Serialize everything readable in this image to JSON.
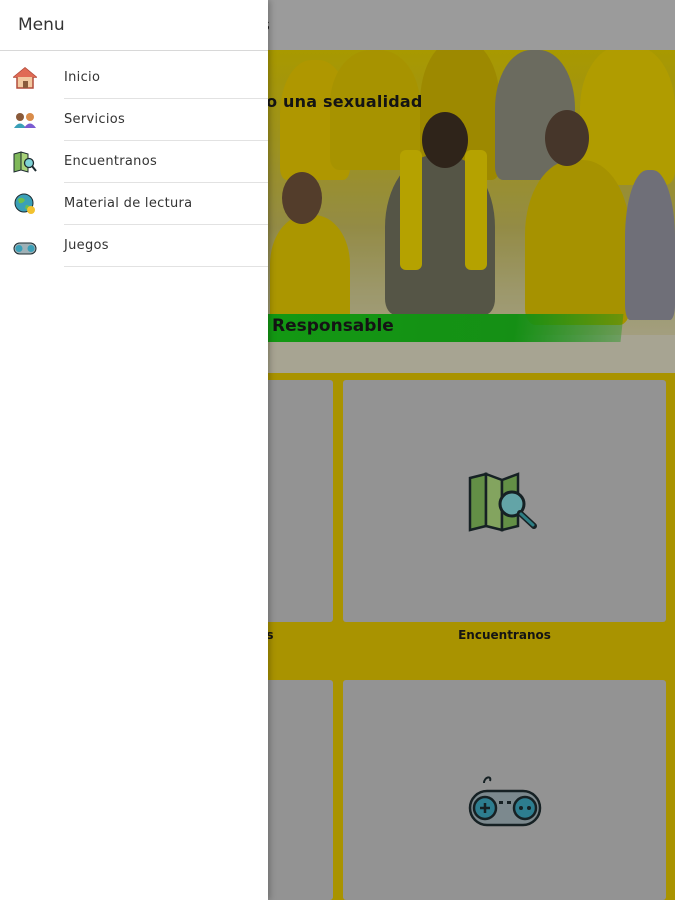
{
  "appbar": {
    "title_fragment": "s"
  },
  "hero": {
    "line1": "ro una sexualidad",
    "line2": "Responsable"
  },
  "tiles": [
    {
      "label": "s"
    },
    {
      "label": "Encuentranos",
      "icon": "map-search-icon"
    },
    {
      "label": ""
    },
    {
      "label": "",
      "icon": "gamepad-icon"
    }
  ],
  "drawer": {
    "title": "Menu",
    "items": [
      {
        "label": "Inicio",
        "icon": "home-icon"
      },
      {
        "label": "Servicios",
        "icon": "people-icon"
      },
      {
        "label": "Encuentranos",
        "icon": "map-icon"
      },
      {
        "label": "Material de lectura",
        "icon": "globe-icon"
      },
      {
        "label": "Juegos",
        "icon": "gamepad-icon"
      }
    ]
  },
  "colors": {
    "brand_yellow": "#d9bd00",
    "banner_green": "#19c419",
    "tile_gray": "#bdbdbd"
  }
}
